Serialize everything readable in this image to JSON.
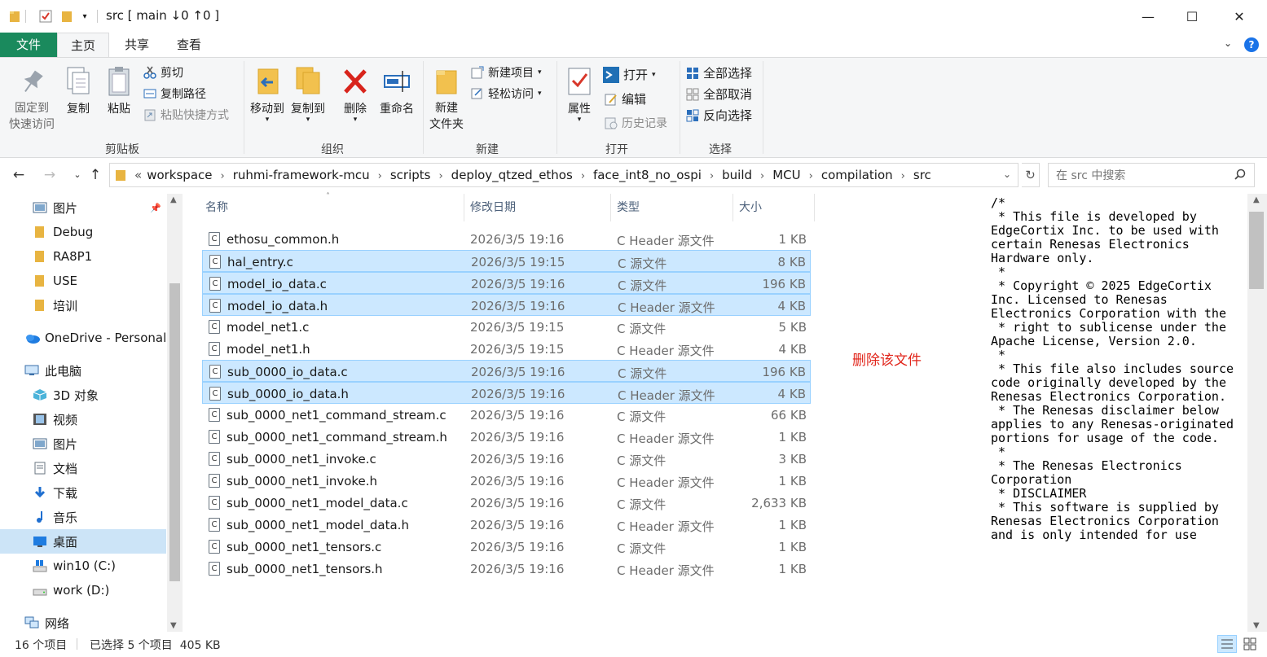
{
  "window": {
    "title": "src [ main ↓0 ↑0 ]",
    "controls": [
      "—",
      "☐",
      "✕"
    ]
  },
  "ribbon_tabs": [
    "文件",
    "主页",
    "共享",
    "查看"
  ],
  "ribbon": {
    "clipboard": {
      "pin_label": "固定到\n快速访问",
      "copy_label": "复制",
      "paste_label": "粘贴",
      "cut_label": "剪切",
      "copy_path_label": "复制路径",
      "paste_shortcut_label": "粘贴快捷方式",
      "group_label": "剪贴板"
    },
    "organize": {
      "move_to_label": "移动到",
      "copy_to_label": "复制到",
      "delete_label": "删除",
      "rename_label": "重命名",
      "group_label": "组织"
    },
    "new": {
      "new_folder_label": "新建\n文件夹",
      "new_item_label": "新建项目",
      "easy_access_label": "轻松访问",
      "group_label": "新建"
    },
    "open": {
      "properties_label": "属性",
      "open_label": "打开",
      "edit_label": "编辑",
      "history_label": "历史记录",
      "group_label": "打开"
    },
    "select": {
      "select_all_label": "全部选择",
      "select_none_label": "全部取消",
      "invert_label": "反向选择",
      "group_label": "选择"
    }
  },
  "address": {
    "breadcrumbs": [
      "workspace",
      "ruhmi-framework-mcu",
      "scripts",
      "deploy_qtzed_ethos",
      "face_int8_no_ospi",
      "build",
      "MCU",
      "compilation",
      "src"
    ],
    "overflow": "«",
    "search_placeholder": "在 src 中搜索"
  },
  "sidebar": {
    "items": [
      {
        "label": "图片",
        "icon": "pictures-icon",
        "pinned": true
      },
      {
        "label": "Debug",
        "icon": "folder-icon"
      },
      {
        "label": "RA8P1",
        "icon": "folder-icon"
      },
      {
        "label": "USE",
        "icon": "folder-icon"
      },
      {
        "label": "培训",
        "icon": "folder-icon"
      },
      {
        "label": "OneDrive - Personal",
        "icon": "onedrive-icon"
      },
      {
        "label": "此电脑",
        "icon": "this-pc-icon"
      },
      {
        "label": "3D 对象",
        "icon": "3d-objects-icon"
      },
      {
        "label": "视频",
        "icon": "videos-icon"
      },
      {
        "label": "图片",
        "icon": "pictures-icon"
      },
      {
        "label": "文档",
        "icon": "documents-icon"
      },
      {
        "label": "下载",
        "icon": "downloads-icon"
      },
      {
        "label": "音乐",
        "icon": "music-icon"
      },
      {
        "label": "桌面",
        "icon": "desktop-icon",
        "selected": true
      },
      {
        "label": "win10 (C:)",
        "icon": "windows-drive-icon"
      },
      {
        "label": "work (D:)",
        "icon": "drive-icon"
      },
      {
        "label": "网络",
        "icon": "network-icon"
      }
    ]
  },
  "filelist": {
    "columns": [
      "名称",
      "修改日期",
      "类型",
      "大小"
    ],
    "rows": [
      {
        "name": "ethosu_common.h",
        "date": "2026/3/5 19:16",
        "type": "C Header 源文件",
        "size": "1 KB",
        "selected": false
      },
      {
        "name": "hal_entry.c",
        "date": "2026/3/5 19:15",
        "type": "C 源文件",
        "size": "8 KB",
        "selected": true
      },
      {
        "name": "model_io_data.c",
        "date": "2026/3/5 19:16",
        "type": "C 源文件",
        "size": "196 KB",
        "selected": true
      },
      {
        "name": "model_io_data.h",
        "date": "2026/3/5 19:16",
        "type": "C Header 源文件",
        "size": "4 KB",
        "selected": true
      },
      {
        "name": "model_net1.c",
        "date": "2026/3/5 19:15",
        "type": "C 源文件",
        "size": "5 KB",
        "selected": false
      },
      {
        "name": "model_net1.h",
        "date": "2026/3/5 19:15",
        "type": "C Header 源文件",
        "size": "4 KB",
        "selected": false
      },
      {
        "name": "sub_0000_io_data.c",
        "date": "2026/3/5 19:16",
        "type": "C 源文件",
        "size": "196 KB",
        "selected": true
      },
      {
        "name": "sub_0000_io_data.h",
        "date": "2026/3/5 19:16",
        "type": "C Header 源文件",
        "size": "4 KB",
        "selected": true
      },
      {
        "name": "sub_0000_net1_command_stream.c",
        "date": "2026/3/5 19:16",
        "type": "C 源文件",
        "size": "66 KB",
        "selected": false
      },
      {
        "name": "sub_0000_net1_command_stream.h",
        "date": "2026/3/5 19:16",
        "type": "C Header 源文件",
        "size": "1 KB",
        "selected": false
      },
      {
        "name": "sub_0000_net1_invoke.c",
        "date": "2026/3/5 19:16",
        "type": "C 源文件",
        "size": "3 KB",
        "selected": false
      },
      {
        "name": "sub_0000_net1_invoke.h",
        "date": "2026/3/5 19:16",
        "type": "C Header 源文件",
        "size": "1 KB",
        "selected": false
      },
      {
        "name": "sub_0000_net1_model_data.c",
        "date": "2026/3/5 19:16",
        "type": "C 源文件",
        "size": "2,633 KB",
        "selected": false
      },
      {
        "name": "sub_0000_net1_model_data.h",
        "date": "2026/3/5 19:16",
        "type": "C Header 源文件",
        "size": "1 KB",
        "selected": false
      },
      {
        "name": "sub_0000_net1_tensors.c",
        "date": "2026/3/5 19:16",
        "type": "C 源文件",
        "size": "1 KB",
        "selected": false
      },
      {
        "name": "sub_0000_net1_tensors.h",
        "date": "2026/3/5 19:16",
        "type": "C Header 源文件",
        "size": "1 KB",
        "selected": false
      }
    ],
    "annotation": "删除该文件"
  },
  "preview": {
    "text": "/*\n * This file is developed by EdgeCortix Inc. to be used with certain Renesas Electronics Hardware only.\n *\n * Copyright © 2025 EdgeCortix Inc. Licensed to Renesas Electronics Corporation with the\n * right to sublicense under the Apache License, Version 2.0.\n *\n * This file also includes source code originally developed by the Renesas Electronics Corporation.\n * The Renesas disclaimer below applies to any Renesas-originated portions for usage of the code.\n *\n * The Renesas Electronics Corporation\n * DISCLAIMER\n * This software is supplied by Renesas Electronics Corporation and is only intended for use"
  },
  "status": {
    "count": "16 个项目",
    "selection": "已选择 5 个项目  405 KB"
  },
  "colors": {
    "file_tab": "#1a8a5d",
    "selection": "#cce8ff",
    "annotation": "#e1251b"
  }
}
